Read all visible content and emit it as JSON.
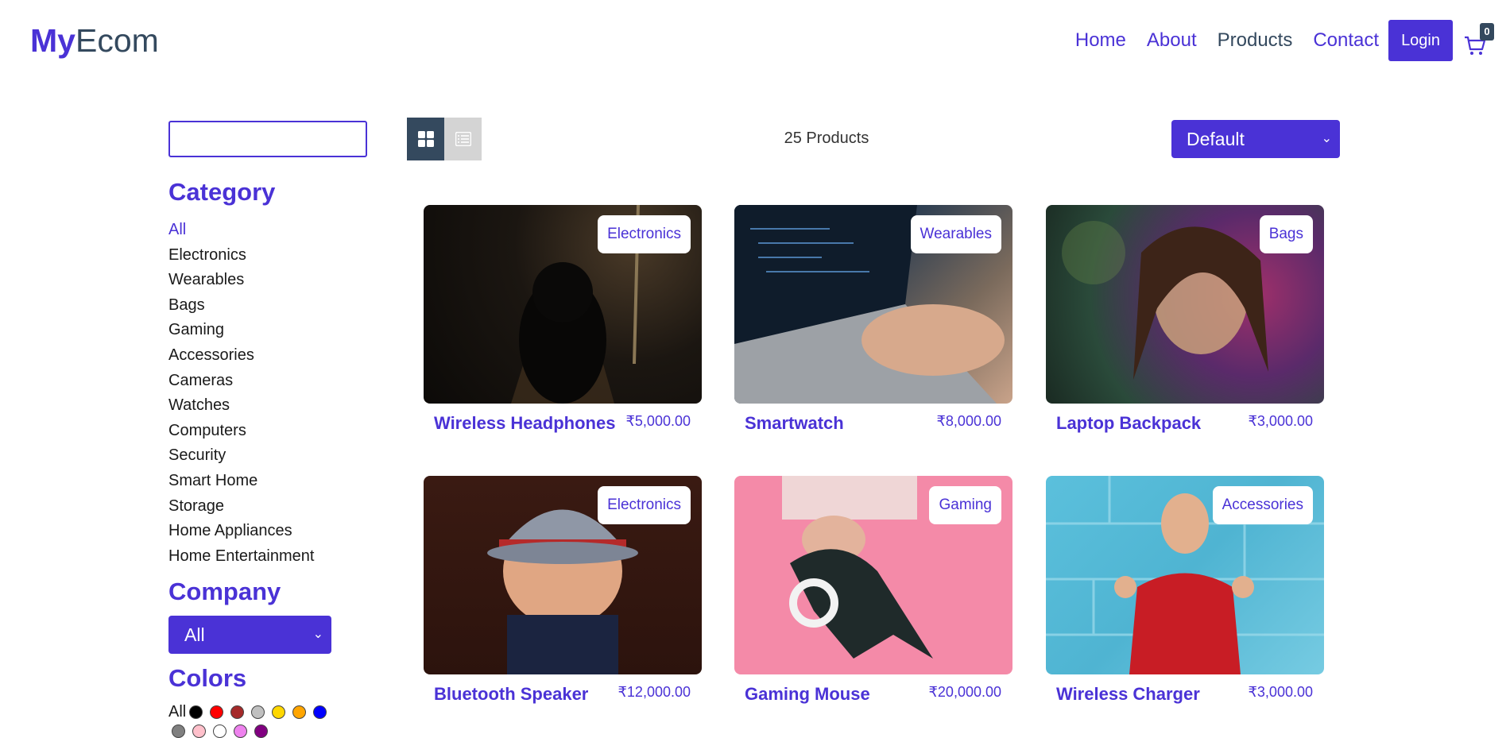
{
  "header": {
    "logo_bold": "My",
    "logo_rest": "Ecom",
    "nav": [
      "Home",
      "About",
      "Products",
      "Contact"
    ],
    "login_label": "Login",
    "cart_count": "0"
  },
  "sidebar": {
    "search_value": "",
    "category_heading": "Category",
    "categories": [
      "All",
      "Electronics",
      "Wearables",
      "Bags",
      "Gaming",
      "Accessories",
      "Cameras",
      "Watches",
      "Computers",
      "Security",
      "Smart Home",
      "Storage",
      "Home Appliances",
      "Home Entertainment"
    ],
    "company_heading": "Company",
    "company_selected": "All",
    "colors_heading": "Colors",
    "colors_all_label": "All",
    "colors": [
      "#000000",
      "#ff0000",
      "#a52a2a",
      "#c0c0c0",
      "#ffd700",
      "#ffa500",
      "#0000ff"
    ],
    "colors_row2": [
      "#808080",
      "#ffc0cb",
      "#ffffff",
      "#ee82ee",
      "#800080"
    ]
  },
  "toolbar": {
    "count_text": "25 Products",
    "sort_selected": "Default"
  },
  "products": [
    {
      "name": "Wireless Headphones",
      "price": "₹5,000.00",
      "category": "Electronics"
    },
    {
      "name": "Smartwatch",
      "price": "₹8,000.00",
      "category": "Wearables"
    },
    {
      "name": "Laptop Backpack",
      "price": "₹3,000.00",
      "category": "Bags"
    },
    {
      "name": "Bluetooth Speaker",
      "price": "₹12,000.00",
      "category": "Electronics"
    },
    {
      "name": "Gaming Mouse",
      "price": "₹20,000.00",
      "category": "Gaming"
    },
    {
      "name": "Wireless Charger",
      "price": "₹3,000.00",
      "category": "Accessories"
    }
  ],
  "colors": {
    "accent": "#4a32d6",
    "dark": "#34495e"
  }
}
